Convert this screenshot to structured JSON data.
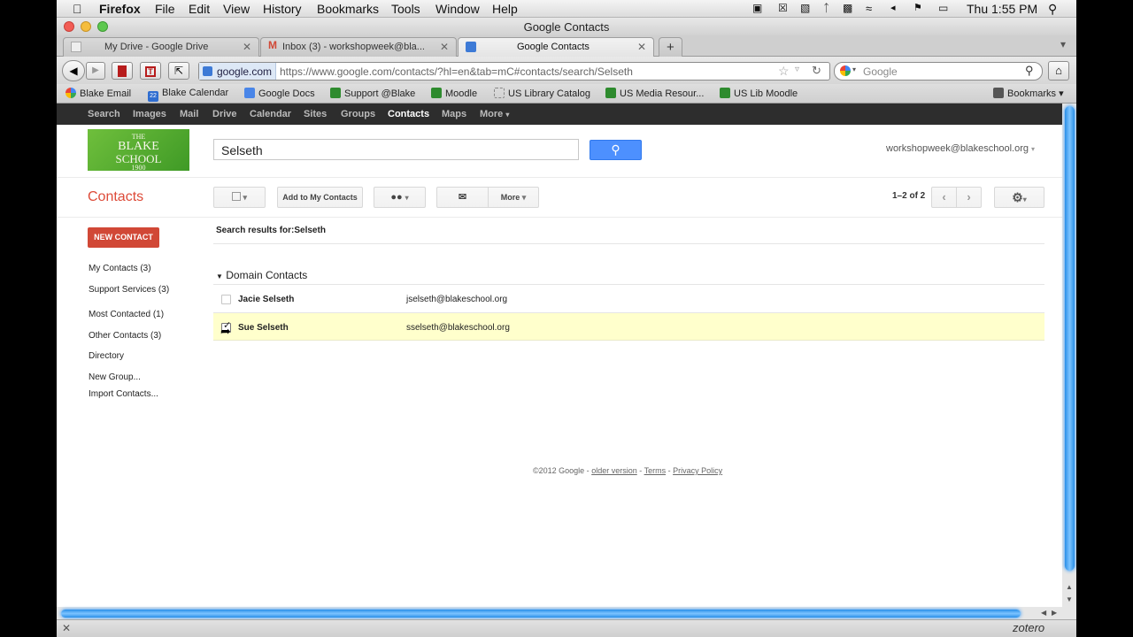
{
  "menubar": {
    "app": "Firefox",
    "items": [
      "File",
      "Edit",
      "View",
      "History",
      "Bookmarks",
      "Tools",
      "Window",
      "Help"
    ],
    "clock": "Thu 1:55 PM"
  },
  "window": {
    "title": "Google Contacts"
  },
  "tabs": [
    {
      "label": "My Drive - Google Drive"
    },
    {
      "label": "Inbox (3) - workshopweek@bla..."
    },
    {
      "label": "Google Contacts"
    }
  ],
  "nav": {
    "domain": "google.com",
    "url": "https://www.google.com/contacts/?hl=en&tab=mC#contacts/search/Selseth",
    "search_placeholder": "Google"
  },
  "bookmarks": [
    {
      "label": "Blake Email",
      "icon": "google-icon"
    },
    {
      "label": "Blake Calendar",
      "icon": "calendar-icon"
    },
    {
      "label": "Google Docs",
      "icon": "docs-icon"
    },
    {
      "label": "Support @Blake",
      "icon": "paw-icon"
    },
    {
      "label": "Moodle",
      "icon": "paw-icon"
    },
    {
      "label": "US Library Catalog",
      "icon": "page-icon"
    },
    {
      "label": "US Media Resour...",
      "icon": "paw-icon"
    },
    {
      "label": "US Lib Moodle",
      "icon": "paw-icon"
    }
  ],
  "bookmarks_menu": "Bookmarks",
  "gbar": [
    "Search",
    "Images",
    "Mail",
    "Drive",
    "Calendar",
    "Sites",
    "Groups",
    "Contacts",
    "Maps",
    "More"
  ],
  "logo": {
    "line1": "THE",
    "line2": "BLAKE",
    "line3": "SCHOOL",
    "line4": "1900"
  },
  "search": {
    "value": "Selseth"
  },
  "account": "workshopweek@blakeschool.org",
  "app_title": "Contacts",
  "toolbar": {
    "add_label": "Add to My Contacts",
    "more_label": "More",
    "pagination": "1–2 of 2"
  },
  "sidebar": {
    "new_contact": "NEW CONTACT",
    "items": [
      "My Contacts (3)",
      "Support Services (3)",
      "Most Contacted (1)",
      "Other Contacts (3)",
      "Directory",
      "New Group...",
      "Import Contacts..."
    ]
  },
  "results_heading": "Search results for:Selseth",
  "section": "Domain Contacts",
  "contacts": [
    {
      "name": "Jacie Selseth",
      "email": "jselseth@blakeschool.org",
      "checked": false
    },
    {
      "name": "Sue Selseth",
      "email": "sselseth@blakeschool.org",
      "checked": true
    }
  ],
  "footer": {
    "copyright": "©2012 Google -",
    "older": "older version",
    "sep1": "-",
    "terms": "Terms",
    "sep2": "-",
    "privacy": "Privacy Policy"
  },
  "status": {
    "zotero": "zotero"
  },
  "colors": {
    "accent_red": "#dd4b39",
    "button_blue": "#4d90fe",
    "new_contact_red": "#d14836",
    "selected_row": "#ffffcc"
  }
}
